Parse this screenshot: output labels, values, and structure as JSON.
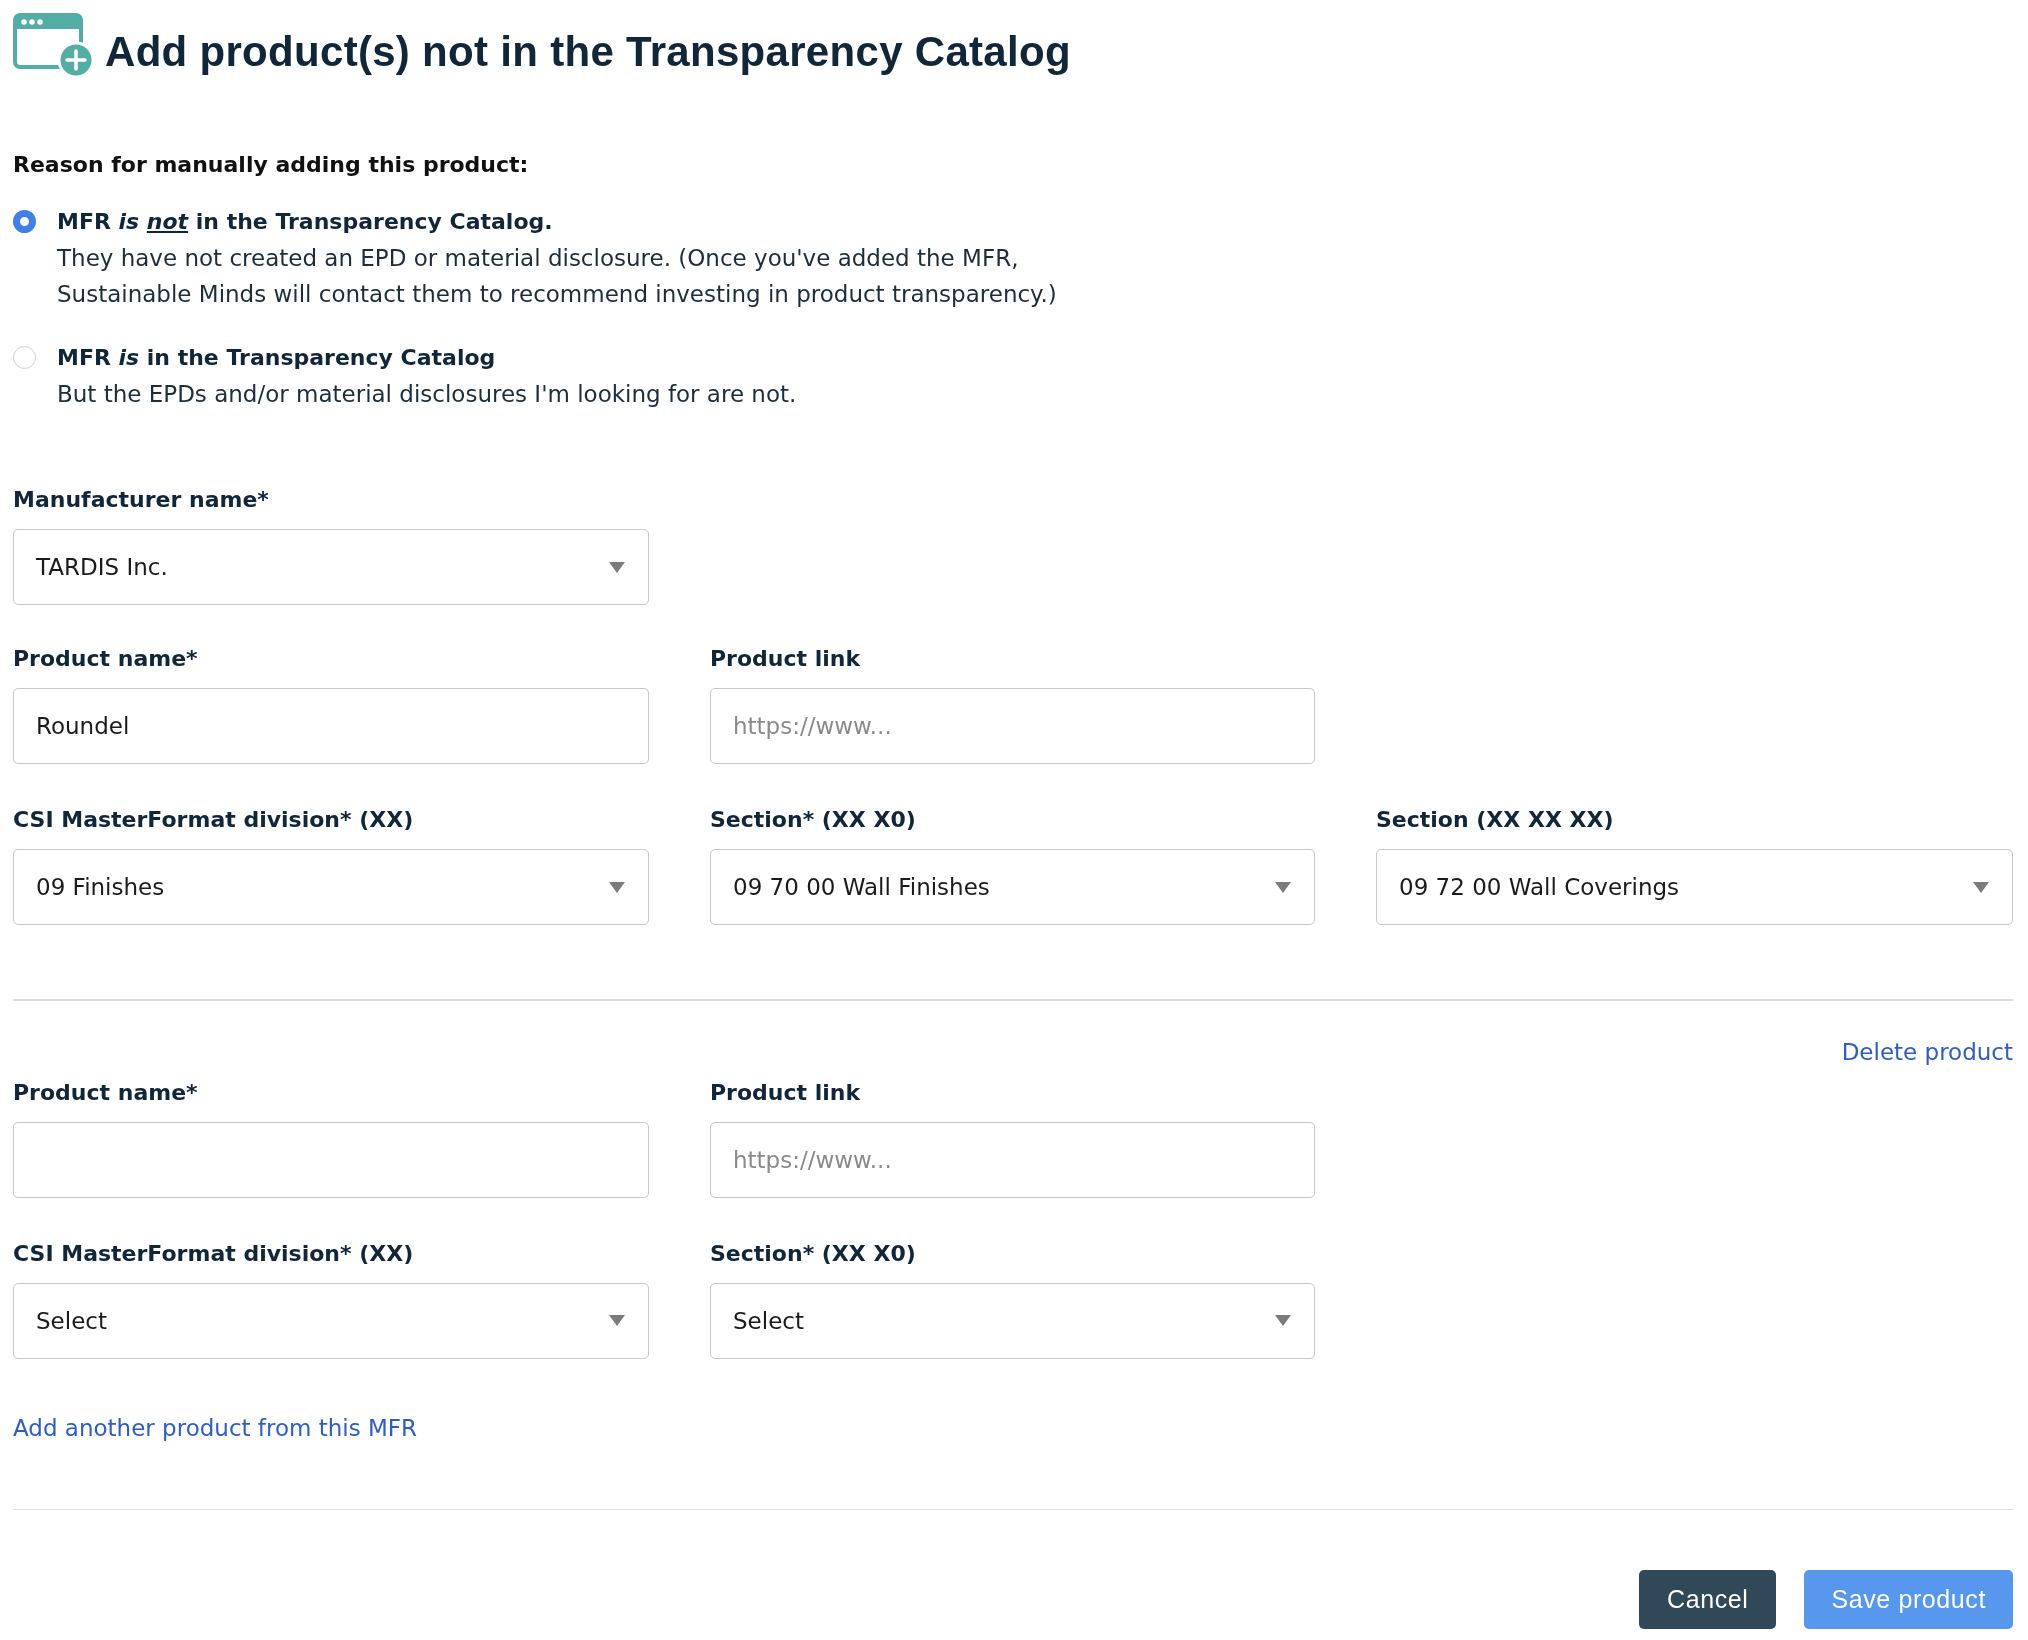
{
  "header": {
    "title": "Add product(s) not in the Transparency Catalog"
  },
  "reason": {
    "label": "Reason for manually adding this product:",
    "options": [
      {
        "selected": true,
        "heading": [
          {
            "text": "MFR ",
            "kind": "plain"
          },
          {
            "text": "is ",
            "kind": "emphasis"
          },
          {
            "text": "not",
            "kind": "stress"
          },
          {
            "text": " in the Transparency Catalog.",
            "kind": "plain"
          }
        ],
        "description": "They have not created an EPD or material disclosure. (Once you've added the MFR, Sustainable Minds will contact them to recommend investing in product transparency.)"
      },
      {
        "selected": false,
        "heading": [
          {
            "text": "MFR ",
            "kind": "plain"
          },
          {
            "text": "is",
            "kind": "emphasis"
          },
          {
            "text": " in the Transparency Catalog",
            "kind": "plain"
          }
        ],
        "description": "But the EPDs and/or material disclosures I'm looking for are not."
      }
    ]
  },
  "manufacturer": {
    "label": "Manufacturer name*",
    "value": "TARDIS Inc."
  },
  "products": [
    {
      "name": {
        "label": "Product name*",
        "value": "Roundel"
      },
      "link": {
        "label": "Product link",
        "placeholder": "https://www..."
      },
      "classification": [
        {
          "label": "CSI MasterFormat division* (XX)",
          "value": "09 Finishes"
        },
        {
          "label": "Section* (XX X0)",
          "value": "09 70 00 Wall Finishes"
        },
        {
          "label": "Section (XX XX XX)",
          "value": "09 72 00 Wall Coverings"
        }
      ]
    },
    {
      "delete_label": "Delete product",
      "name": {
        "label": "Product name*"
      },
      "link": {
        "label": "Product link",
        "placeholder": "https://www..."
      },
      "classification": [
        {
          "label": "CSI MasterFormat division* (XX)",
          "value": "Select"
        },
        {
          "label": "Section* (XX X0)",
          "value": "Select"
        }
      ]
    }
  ],
  "add_link": "Add another product from this MFR",
  "buttons": [
    {
      "label": "Cancel",
      "kind": "secondary"
    },
    {
      "label": "Save product",
      "kind": "primary"
    }
  ]
}
